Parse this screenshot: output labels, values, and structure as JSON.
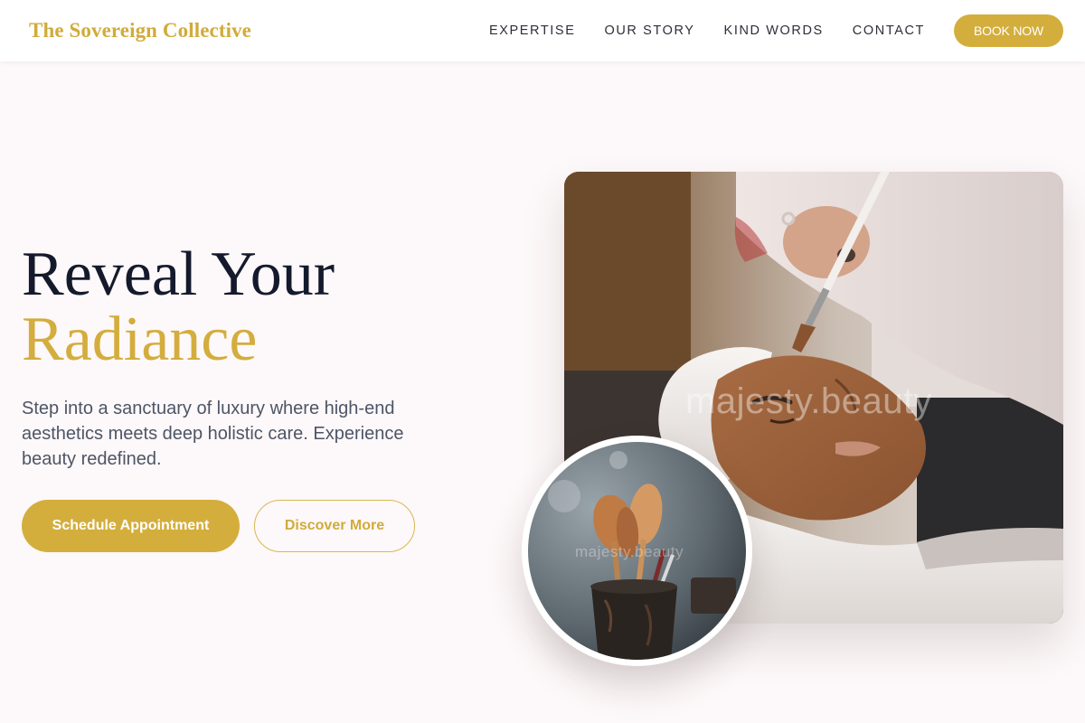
{
  "header": {
    "brand": "The Sovereign Collective",
    "nav": [
      "EXPERTISE",
      "OUR STORY",
      "KIND WORDS",
      "CONTACT"
    ],
    "cta": "BOOK NOW"
  },
  "hero": {
    "title_line1": "Reveal Your",
    "title_line2": "Radiance",
    "description": "Step into a sanctuary of luxury where high-end aesthetics meets deep holistic care. Experience beauty redefined.",
    "primary_button": "Schedule Appointment",
    "secondary_button": "Discover More"
  },
  "images": {
    "main_watermark": "majesty.beauty",
    "circle_watermark": "majesty.beauty"
  },
  "colors": {
    "accent": "#d4ae3c",
    "heading": "#141a2c",
    "body_text": "#4d5566",
    "background": "#fdf8f9"
  }
}
